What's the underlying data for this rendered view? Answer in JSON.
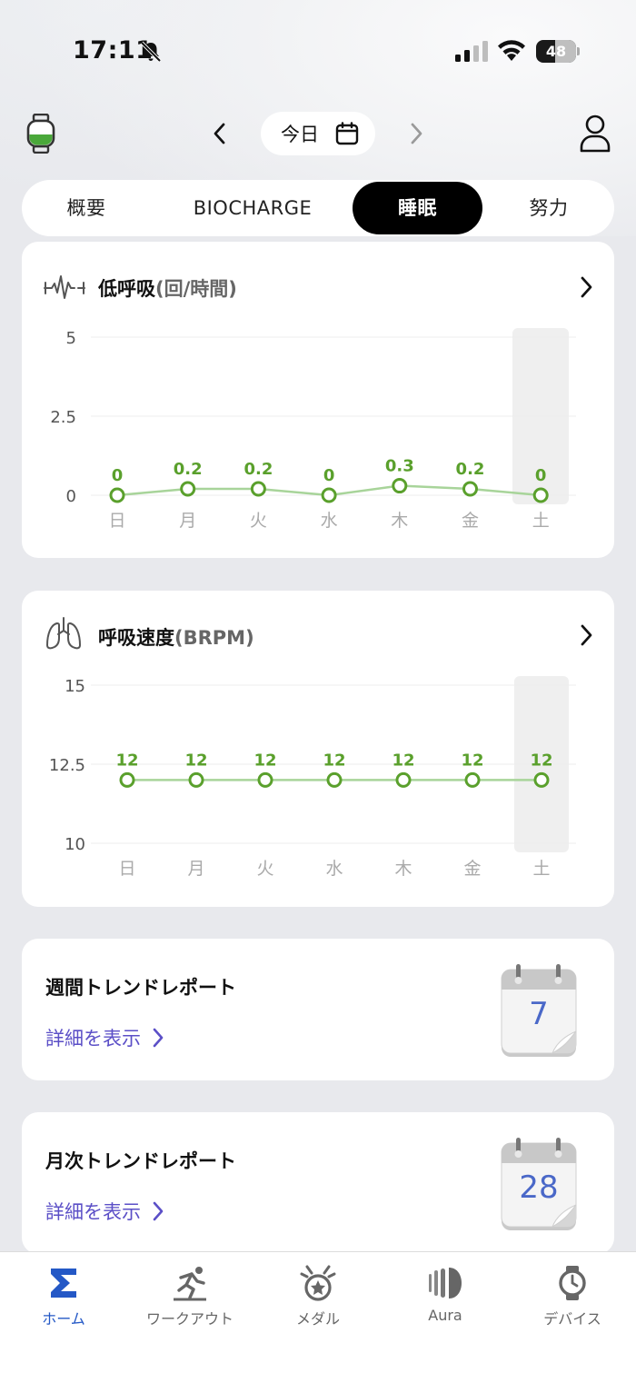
{
  "status_bar": {
    "time": "17:11",
    "battery": "48"
  },
  "header": {
    "date_label": "今日"
  },
  "tabs": [
    {
      "label": "概要",
      "active": false
    },
    {
      "label": "BIOCHARGE",
      "active": false
    },
    {
      "label": "睡眠",
      "active": true
    },
    {
      "label": "努力",
      "active": false
    }
  ],
  "hypopnea_card": {
    "title": "低呼吸",
    "unit": "(回/時間)",
    "icon": "heartbeat-icon"
  },
  "respiration_card": {
    "title": "呼吸速度",
    "unit": "(BRPM)",
    "icon": "lungs-icon"
  },
  "chart_data": [
    {
      "type": "line",
      "title": "低呼吸(回/時間)",
      "categories": [
        "日",
        "月",
        "火",
        "水",
        "木",
        "金",
        "土"
      ],
      "values": [
        0,
        0.2,
        0.2,
        0,
        0.3,
        0.2,
        0
      ],
      "value_labels": [
        "0",
        "0.2",
        "0.2",
        "0",
        "0.3",
        "0.2",
        "0"
      ],
      "y_ticks": [
        "5",
        "2.5",
        "0"
      ],
      "ylim": [
        0,
        5
      ],
      "highlight_category": "土",
      "color": "#5aa02c",
      "line_color": "#a8d49a"
    },
    {
      "type": "line",
      "title": "呼吸速度(BRPM)",
      "categories": [
        "日",
        "月",
        "火",
        "水",
        "木",
        "金",
        "土"
      ],
      "values": [
        12,
        12,
        12,
        12,
        12,
        12,
        12
      ],
      "value_labels": [
        "12",
        "12",
        "12",
        "12",
        "12",
        "12",
        "12"
      ],
      "y_ticks": [
        "15",
        "12.5",
        "10"
      ],
      "ylim": [
        10,
        15
      ],
      "highlight_category": "土",
      "color": "#5aa02c",
      "line_color": "#a8d49a"
    }
  ],
  "weekly_report": {
    "title": "週間トレンドレポート",
    "link": "詳細を表示",
    "calendar_number": "7"
  },
  "monthly_report": {
    "title": "月次トレンドレポート",
    "link": "詳細を表示",
    "calendar_number": "28"
  },
  "bottom_nav": [
    {
      "label": "ホーム",
      "icon": "sigma-icon",
      "active": true
    },
    {
      "label": "ワークアウト",
      "icon": "runner-icon",
      "active": false
    },
    {
      "label": "メダル",
      "icon": "medal-icon",
      "active": false
    },
    {
      "label": "Aura",
      "icon": "aura-icon",
      "active": false
    },
    {
      "label": "デバイス",
      "icon": "watch-icon",
      "active": false
    }
  ],
  "colors": {
    "accent": "#5aa02c",
    "link": "#5b4fc7",
    "nav_active": "#2458c6"
  }
}
